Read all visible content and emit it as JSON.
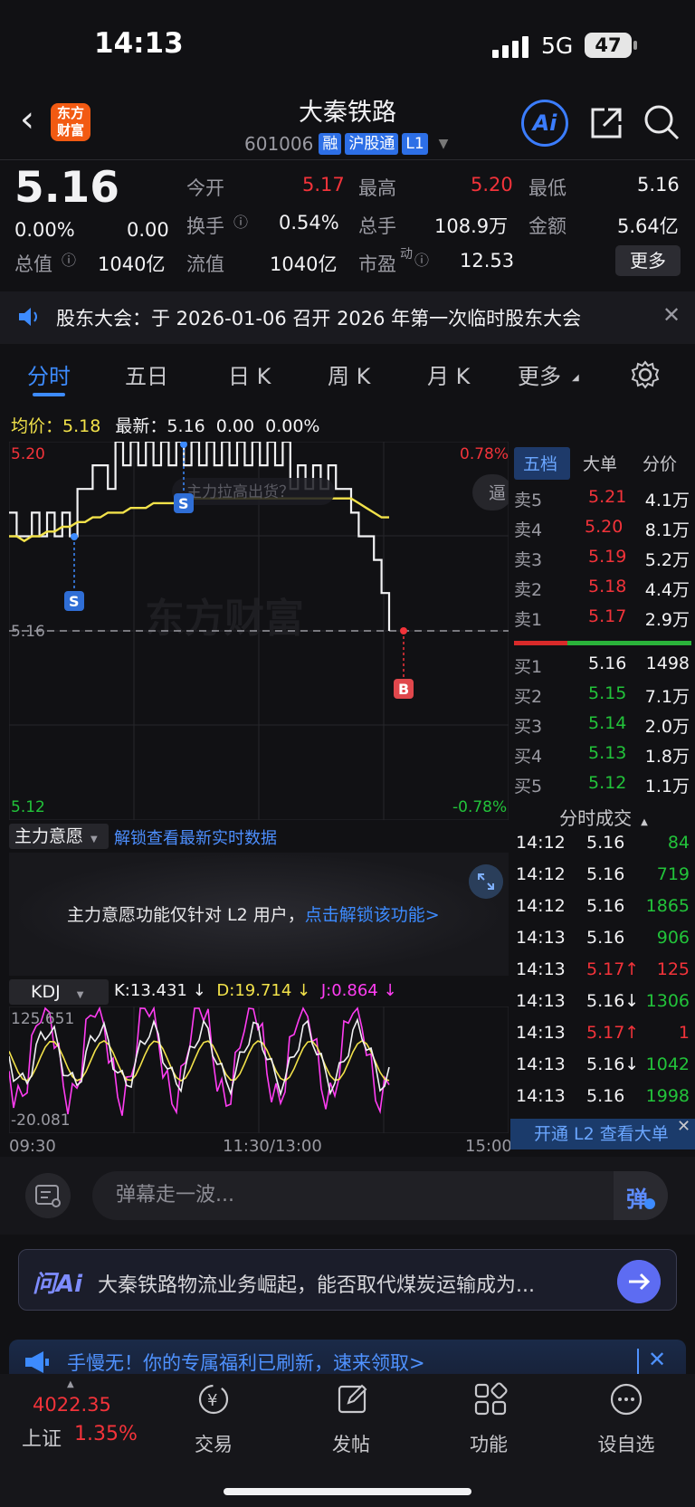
{
  "status_bar": {
    "time": "14:13",
    "network": "5G",
    "battery": "47"
  },
  "header": {
    "logo_line1": "东方",
    "logo_line2": "财富",
    "title": "大秦铁路",
    "code": "601006",
    "tags": [
      "融",
      "沪股通",
      "L1"
    ],
    "ai_label": "Ai"
  },
  "quote": {
    "price": "5.16",
    "change_pct": "0.00%",
    "change": "0.00",
    "open_label": "今开",
    "open": "5.17",
    "high_label": "最高",
    "high": "5.20",
    "low_label": "最低",
    "low": "5.16",
    "turnover_label": "换手",
    "turnover": "0.54%",
    "volume_label": "总手",
    "volume": "108.9万",
    "amount_label": "金额",
    "amount": "5.64亿",
    "mktcap_label": "总值",
    "mktcap": "1040亿",
    "float_label": "流值",
    "float": "1040亿",
    "pe_label": "市盈",
    "pe_sup": "动",
    "pe": "12.53",
    "more_label": "更多"
  },
  "notice": {
    "text": "股东大会：于 2026-01-06 召开 2026 年第一次临时股东大会"
  },
  "tabs": [
    "分时",
    "五日",
    "日 K",
    "周 K",
    "月 K",
    "更多"
  ],
  "intraday": {
    "avg_label": "均价：",
    "avg": "5.18",
    "latest_label": "最新：",
    "latest": "5.16",
    "latest_change": "0.00",
    "latest_pct": "0.00%",
    "axis_top": "5.20",
    "axis_mid": "5.16",
    "axis_bottom": "5.12",
    "pct_top": "0.78%",
    "pct_bottom": "-0.78%",
    "watermark": "东方财富",
    "overlay_text": "主力拉高出货？",
    "overlay_btn": "逼",
    "marker_sell": "S",
    "marker_buy": "B",
    "time_start": "09:30",
    "time_mid": "11:30/13:00",
    "time_end": "15:00"
  },
  "chart_data": {
    "type": "line",
    "ylim": [
      5.12,
      5.2
    ],
    "series": [
      {
        "values": [
          5.185,
          5.18,
          5.18,
          5.185,
          5.18,
          5.185,
          5.18,
          5.185,
          5.18,
          5.19,
          5.19,
          5.195,
          5.195,
          5.19,
          5.2,
          5.195,
          5.2,
          5.195,
          5.2,
          5.195,
          5.2,
          5.195,
          5.2,
          5.195,
          5.2,
          5.195,
          5.2,
          5.195,
          5.2,
          5.195,
          5.2,
          5.195,
          5.2,
          5.195,
          5.2,
          5.195,
          5.2,
          5.19,
          5.195,
          5.19,
          5.195,
          5.19,
          5.195,
          5.19,
          5.19,
          5.185,
          5.18,
          5.18,
          5.175,
          5.168,
          5.16
        ]
      },
      {
        "values": [
          5.18,
          5.18,
          5.179,
          5.18,
          5.18,
          5.181,
          5.181,
          5.182,
          5.182,
          5.183,
          5.183,
          5.184,
          5.184,
          5.185,
          5.185,
          5.185,
          5.186,
          5.186,
          5.186,
          5.187,
          5.187,
          5.187,
          5.187,
          5.187,
          5.188,
          5.188,
          5.188,
          5.188,
          5.188,
          5.188,
          5.188,
          5.188,
          5.188,
          5.188,
          5.188,
          5.188,
          5.188,
          5.188,
          5.188,
          5.188,
          5.188,
          5.188,
          5.188,
          5.188,
          5.188,
          5.188,
          5.187,
          5.186,
          5.185,
          5.184,
          5.184
        ]
      }
    ]
  },
  "intent": {
    "label": "主力意愿",
    "link": "解锁查看最新实时数据",
    "text": "主力意愿功能仅针对 L2 用户，",
    "unlock": "点击解锁该功能>"
  },
  "kdj": {
    "label": "KDJ",
    "k": "K:13.431 ↓",
    "d": "D:19.714 ↓",
    "j": "J:0.864 ↓",
    "top": "125.651",
    "bottom": "-20.081"
  },
  "right_panel": {
    "tabs": [
      "五档",
      "大单",
      "分价"
    ],
    "asks": [
      {
        "label": "卖5",
        "price": "5.21",
        "vol": "4.1万"
      },
      {
        "label": "卖4",
        "price": "5.20",
        "vol": "8.1万"
      },
      {
        "label": "卖3",
        "price": "5.19",
        "vol": "5.2万"
      },
      {
        "label": "卖2",
        "price": "5.18",
        "vol": "4.4万"
      },
      {
        "label": "卖1",
        "price": "5.17",
        "vol": "2.9万"
      }
    ],
    "bids": [
      {
        "label": "买1",
        "price": "5.16",
        "vol": "1498"
      },
      {
        "label": "买2",
        "price": "5.15",
        "vol": "7.1万"
      },
      {
        "label": "买3",
        "price": "5.14",
        "vol": "2.0万"
      },
      {
        "label": "买4",
        "price": "5.13",
        "vol": "1.8万"
      },
      {
        "label": "买5",
        "price": "5.12",
        "vol": "1.1万"
      }
    ],
    "ticks_title": "分时成交",
    "ticks": [
      {
        "time": "14:12",
        "price": "5.16",
        "vol": "84"
      },
      {
        "time": "14:12",
        "price": "5.16",
        "vol": "719"
      },
      {
        "time": "14:12",
        "price": "5.16",
        "vol": "1865"
      },
      {
        "time": "14:13",
        "price": "5.16",
        "vol": "906"
      },
      {
        "time": "14:13",
        "price": "5.17↑",
        "vol": "125"
      },
      {
        "time": "14:13",
        "price": "5.16↓",
        "vol": "1306"
      },
      {
        "time": "14:13",
        "price": "5.17↑",
        "vol": "1"
      },
      {
        "time": "14:13",
        "price": "5.16↓",
        "vol": "1042"
      },
      {
        "time": "14:13",
        "price": "5.16",
        "vol": "1998"
      }
    ],
    "l2_banner": "开通 L2 查看大单"
  },
  "danmu": {
    "placeholder": "弹幕走一波...",
    "send": "弹"
  },
  "ai_ask": {
    "logo": "问Ai",
    "text": "大秦铁路物流业务崛起，能否取代煤炭运输成为..."
  },
  "promo": {
    "text": "手慢无！你的专属福利已刷新，速来领取>"
  },
  "nav": {
    "index_value": "4022.35",
    "index_name": "上证",
    "index_pct": "1.35%",
    "items": [
      "交易",
      "发帖",
      "功能",
      "设自选"
    ]
  }
}
